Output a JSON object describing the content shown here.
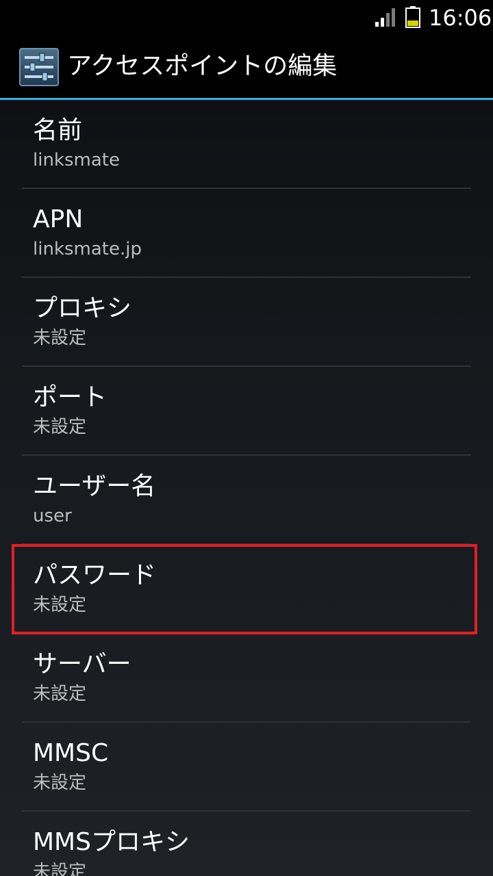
{
  "status_bar": {
    "time": "16:06",
    "signal_icon": "signal-icon",
    "battery_icon": "battery-icon",
    "battery_color": "#d4d400"
  },
  "action_bar": {
    "icon": "settings-sliders-icon",
    "title": "アクセスポイントの編集",
    "accent_color": "#33b5e5"
  },
  "items": [
    {
      "title": "名前",
      "summary": "linksmate"
    },
    {
      "title": "APN",
      "summary": "linksmate.jp"
    },
    {
      "title": "プロキシ",
      "summary": "未設定"
    },
    {
      "title": "ポート",
      "summary": "未設定"
    },
    {
      "title": "ユーザー名",
      "summary": "user"
    },
    {
      "title": "パスワード",
      "summary": "未設定"
    },
    {
      "title": "サーバー",
      "summary": "未設定"
    },
    {
      "title": "MMSC",
      "summary": "未設定"
    },
    {
      "title": "MMSプロキシ",
      "summary": "未設定"
    }
  ],
  "highlight_color": "#e21e26"
}
